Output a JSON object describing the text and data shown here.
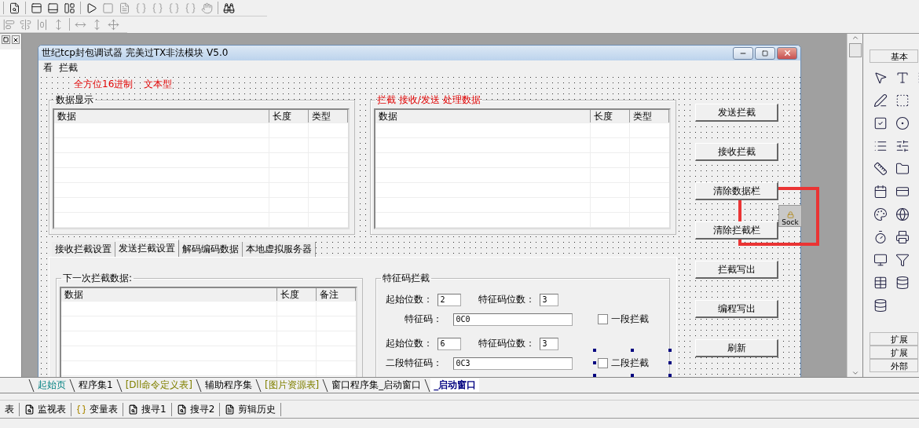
{
  "form": {
    "title": "世纪tcp封包调试器  完美过TX非法模块 V5.0",
    "menu": [
      "看",
      "拦截"
    ],
    "labels": [
      "全方位16进制",
      "文本型"
    ],
    "groups": [
      {
        "title": "数据显示",
        "kind": "plain",
        "columns": [
          "数据",
          "长度",
          "类型"
        ]
      },
      {
        "title": "拦截 接收/发送 处理数据",
        "kind": "accent",
        "columns": [
          "数据",
          "长度",
          "类型"
        ]
      }
    ],
    "tabs": [
      {
        "label": "接收拦截设置",
        "selected": false
      },
      {
        "label": "发送拦截设置",
        "selected": true
      },
      {
        "label": "解码编码数据",
        "selected": false
      },
      {
        "label": "本地虚拟服务器",
        "selected": false
      }
    ],
    "next_group": {
      "title": "下一次拦截数据:",
      "columns": [
        "数据",
        "长度",
        "备注"
      ]
    },
    "signature": {
      "title": "特征码拦截",
      "segments": [
        {
          "start_label": "起始位数：",
          "start_value": "2",
          "len_label": "特征码位数：",
          "len_value": "3",
          "code_label": "特征码：",
          "code_value": "0C0",
          "check_label": "一段拦截",
          "checked": false,
          "handles": false
        },
        {
          "start_label": "起始位数：",
          "start_value": "6",
          "len_label": "特征码位数：",
          "len_value": "3",
          "code_label": "二段特征码：",
          "code_value": "0C3",
          "check_label": "二段拦截",
          "checked": false,
          "handles": true
        }
      ]
    },
    "buttons": [
      "发送拦截",
      "接收拦截",
      "清除数据栏",
      "清除拦截栏",
      "拦截写出",
      "编程写出",
      "刷新"
    ],
    "socket_label": "Sock"
  },
  "palette": {
    "header": "基本",
    "footers": [
      "扩展",
      "扩展",
      "外部"
    ]
  },
  "doc_tabs": [
    {
      "label": "起始页",
      "kind": "start",
      "selected": false
    },
    {
      "label": "程序集1",
      "kind": "code",
      "selected": false
    },
    {
      "label": "[Dll命令定义表]",
      "kind": "table",
      "selected": false
    },
    {
      "label": "辅助程序集",
      "kind": "code",
      "selected": false
    },
    {
      "label": "[图片资源表]",
      "kind": "table",
      "selected": false
    },
    {
      "label": "窗口程序集_启动窗口",
      "kind": "code",
      "selected": false
    },
    {
      "label": "_启动窗口",
      "kind": "window",
      "selected": true
    }
  ],
  "bottom_tabs": [
    "表",
    "监视表",
    "变量表",
    "搜寻1",
    "搜寻2",
    "剪辑历史"
  ]
}
